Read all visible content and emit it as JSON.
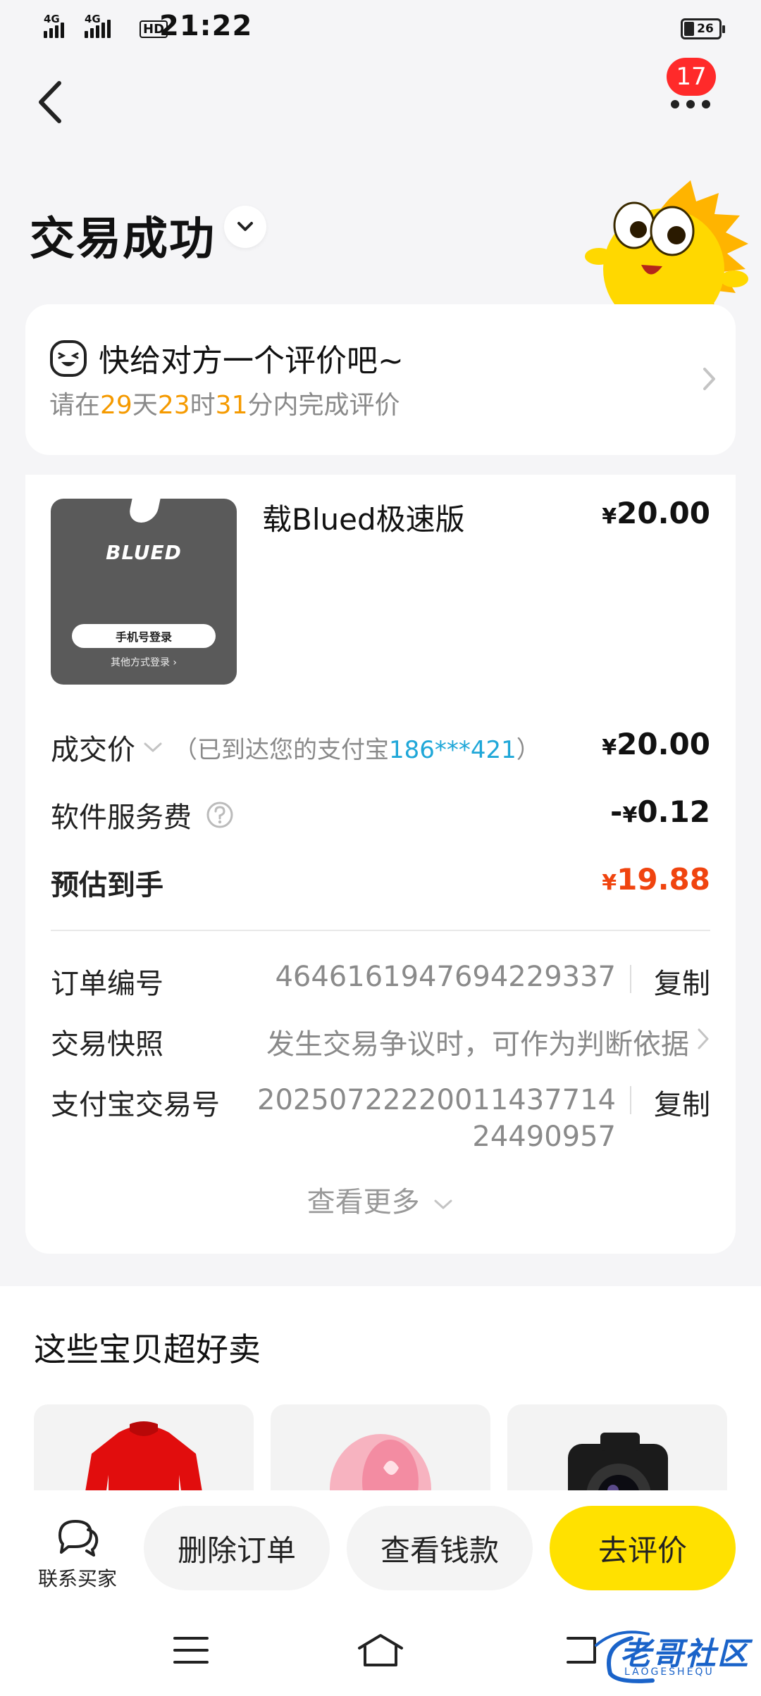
{
  "status_bar": {
    "network_1": "4G",
    "network_2": "4G",
    "hd": "HD",
    "time": "21:22",
    "battery": "26"
  },
  "header": {
    "notification_count": "17",
    "title": "交易成功"
  },
  "review_prompt": {
    "title": "快给对方一个评价吧~",
    "prefix": "请在",
    "days": "29",
    "days_unit": "天",
    "hours": "23",
    "hours_unit": "时",
    "minutes": "31",
    "minutes_unit": "分内完成评价"
  },
  "item": {
    "thumb_brand": "BLUED",
    "thumb_button": "手机号登录",
    "thumb_sub": "其他方式登录 ›",
    "name": "载Blued极速版",
    "price_yen": "¥",
    "price": "20.00"
  },
  "price_rows": {
    "deal_label": "成交价",
    "deal_note_prefix": "（已到达您的支付宝",
    "deal_note_account": "186***421",
    "deal_note_suffix": "）",
    "deal_yen": "¥",
    "deal_value": "20.00",
    "fee_label": "软件服务费",
    "fee_prefix": "-",
    "fee_yen": "¥",
    "fee_value": "0.12",
    "est_label": "预估到手",
    "est_yen": "¥",
    "est_value": "19.88"
  },
  "order_info": {
    "order_no_label": "订单编号",
    "order_no": "4646161947694229337",
    "copy_label": "复制",
    "snapshot_label": "交易快照",
    "snapshot_value": "发生交易争议时，可作为判断依据",
    "alipay_label": "支付宝交易号",
    "alipay_line1": "2025072222001143771​4",
    "alipay_line2": "24490957",
    "see_more": "查看更多"
  },
  "recommendations": {
    "title": "这些宝贝超好卖"
  },
  "actions": {
    "contact_label": "联系买家",
    "delete_label": "删除订单",
    "view_money_label": "查看钱款",
    "review_label": "去评价"
  },
  "watermark": {
    "text": "老哥社区",
    "sub": "LAOGESHEQU"
  },
  "colors": {
    "accent_yellow": "#ffe100",
    "highlight_orange": "#f59a00",
    "price_red": "#f0440f",
    "link_blue": "#1fa7d8",
    "badge_red": "#ff2a2a"
  }
}
